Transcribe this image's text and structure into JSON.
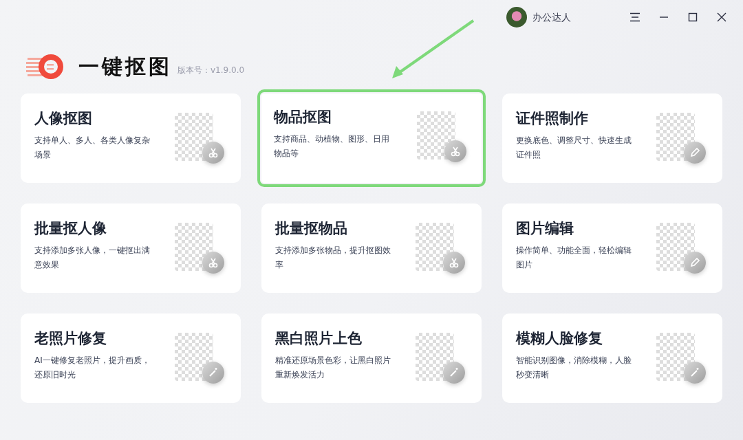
{
  "user": {
    "name": "办公达人"
  },
  "app": {
    "title": "一键抠图",
    "version": "版本号：v1.9.0.0"
  },
  "cards": [
    {
      "title": "人像抠图",
      "description": "支持单人、多人、各类人像复杂场景",
      "kind": "cut",
      "highlighted": false
    },
    {
      "title": "物品抠图",
      "description": "支持商品、动植物、图形、日用物品等",
      "kind": "cut",
      "highlighted": true
    },
    {
      "title": "证件照制作",
      "description": "更换底色、调整尺寸、快速生成证件照",
      "kind": "edit",
      "highlighted": false
    },
    {
      "title": "批量抠人像",
      "description": "支持添加多张人像，一键抠出满意效果",
      "kind": "cut",
      "highlighted": false
    },
    {
      "title": "批量抠物品",
      "description": "支持添加多张物品，提升抠图效率",
      "kind": "cut",
      "highlighted": false
    },
    {
      "title": "图片编辑",
      "description": "操作简单、功能全面，轻松编辑图片",
      "kind": "edit",
      "highlighted": false
    },
    {
      "title": "老照片修复",
      "description": "AI一键修复老照片，提升画质，还原旧时光",
      "kind": "wand",
      "highlighted": false
    },
    {
      "title": "黑白照片上色",
      "description": "精准还原场景色彩，让黑白照片重新焕发活力",
      "kind": "wand",
      "highlighted": false
    },
    {
      "title": "模糊人脸修复",
      "description": "智能识别图像，消除模糊，人脸秒变清晰",
      "kind": "wand",
      "highlighted": false
    }
  ]
}
